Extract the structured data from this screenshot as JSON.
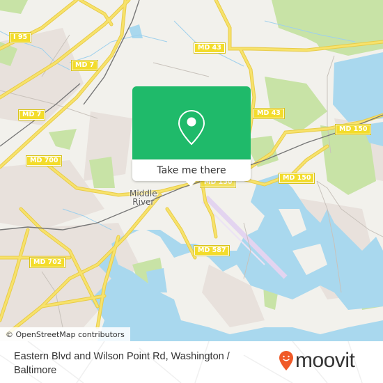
{
  "map": {
    "place_label": "Middle\nRiver",
    "place_label_lines": [
      "Middle",
      "River"
    ],
    "road_shields": [
      {
        "label": "I 95"
      },
      {
        "label": "MD 7"
      },
      {
        "label": "MD 7"
      },
      {
        "label": "MD 43"
      },
      {
        "label": "MD 43"
      },
      {
        "label": "MD 150"
      },
      {
        "label": "MD 700"
      },
      {
        "label": "MD 150"
      },
      {
        "label": "MD 150"
      },
      {
        "label": "MD 587"
      },
      {
        "label": "MD 702"
      }
    ],
    "colors": {
      "land": "#f2f1ec",
      "water": "#a9d8ee",
      "park": "#c8e3a6",
      "residential": "#e8e1dc",
      "road": "#f7e26b",
      "rail": "#777777",
      "runway": "#e3d4f0"
    }
  },
  "popup": {
    "icon": "map-pin-icon",
    "button_label": "Take me there",
    "accent_color": "#1fba6a"
  },
  "attribution": {
    "text": "© OpenStreetMap contributors"
  },
  "footer": {
    "address": "Eastern Blvd and Wilson Point Rd, Washington / Baltimore",
    "brand": "moovit",
    "brand_icon": "moovit-pin-smile-icon",
    "brand_color": "#f05a28"
  }
}
